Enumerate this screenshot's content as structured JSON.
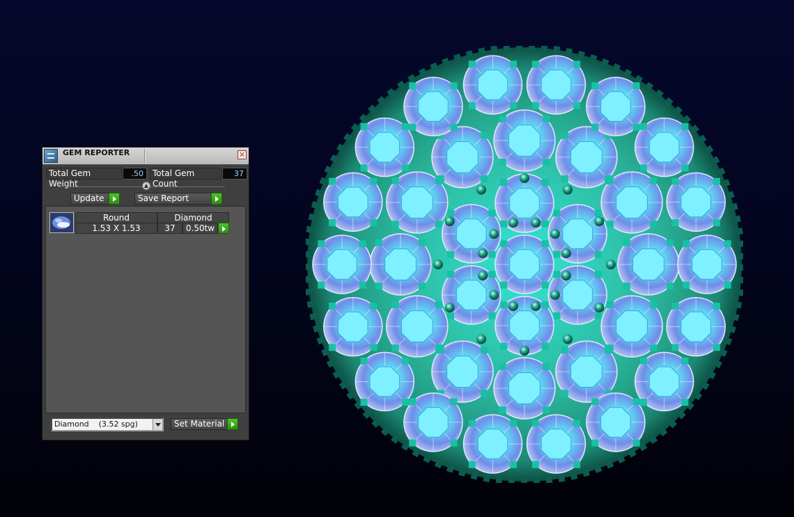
{
  "panel": {
    "title": "GEM REPORTER",
    "total_weight_label": "Total Gem Weight",
    "total_weight_value": ".50",
    "total_count_label": "Total Gem Count",
    "total_count_value": "37",
    "update_label": "Update",
    "save_report_label": "Save Report",
    "row": {
      "shape": "Round",
      "material": "Diamond",
      "size": "1.53 X 1.53",
      "count": "37",
      "weight": "0.50tw"
    },
    "material_select_value": "Diamond    (3.52 spg)",
    "set_material_label": "Set Material"
  },
  "colors": {
    "metal": "#1fa58a",
    "gem": "#8fe8ff",
    "panel_bg": "#3f3f3f",
    "accent_green": "#3aa61f"
  }
}
